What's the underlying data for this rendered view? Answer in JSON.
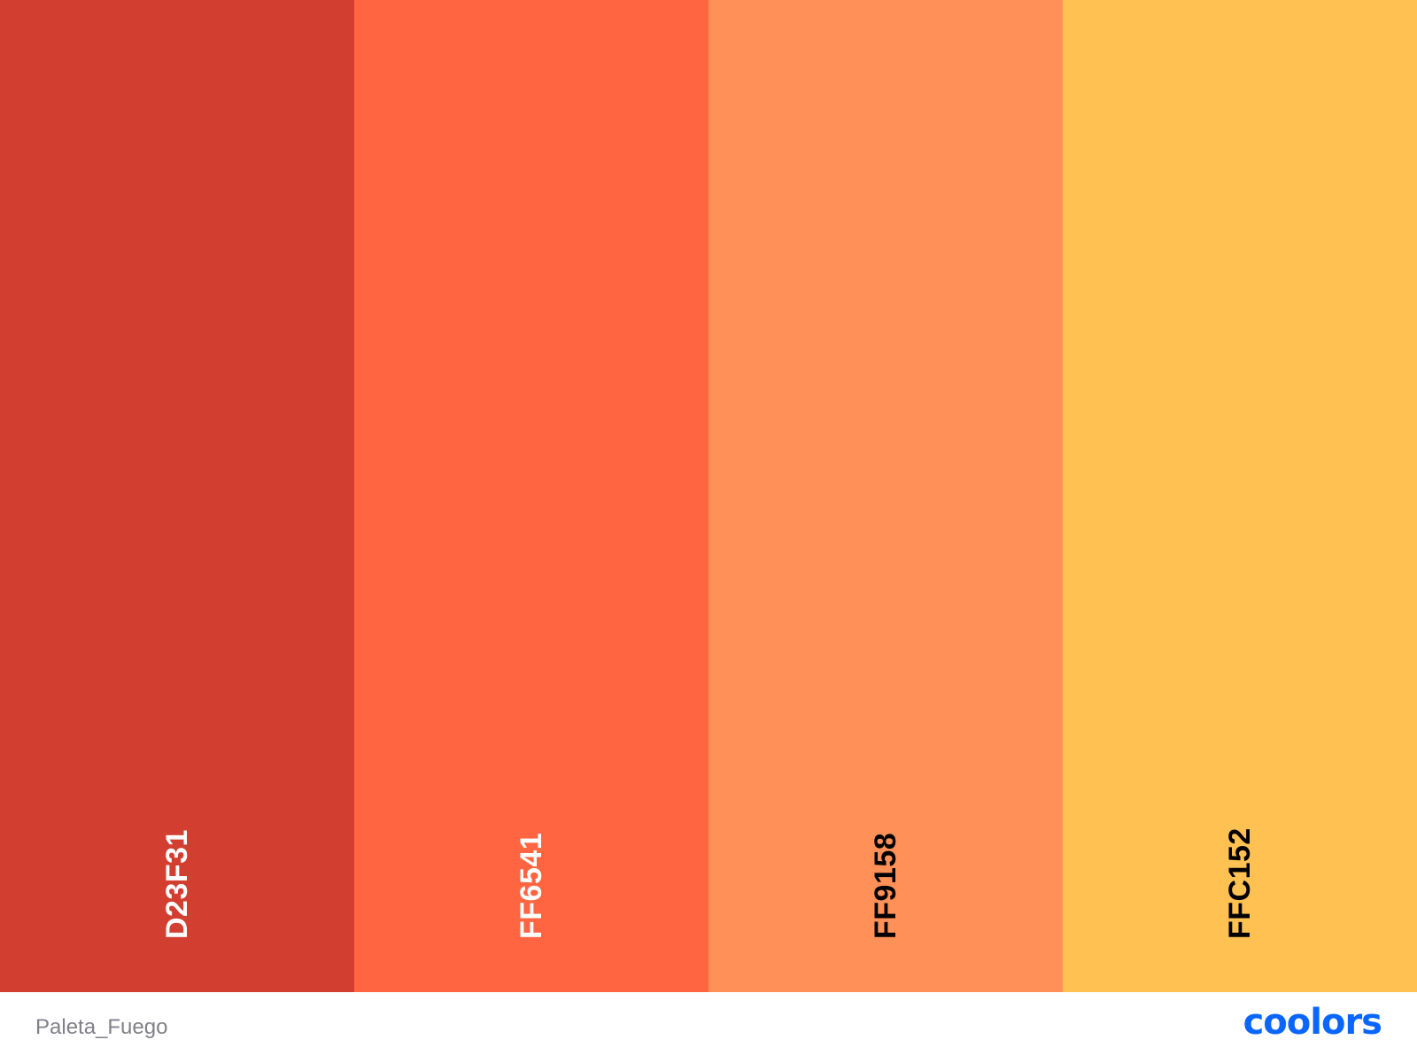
{
  "palette": {
    "name": "Paleta_Fuego",
    "swatches": [
      {
        "hex": "D23F31",
        "color": "#D23F31",
        "text_color": "#ffffff"
      },
      {
        "hex": "FF6541",
        "color": "#FF6541",
        "text_color": "#ffffff"
      },
      {
        "hex": "FF9158",
        "color": "#FF9158",
        "text_color": "#000000"
      },
      {
        "hex": "FFC152",
        "color": "#FFC152",
        "text_color": "#000000"
      }
    ]
  },
  "brand": {
    "logo_text": "coolors",
    "color": "#0A66FF"
  }
}
